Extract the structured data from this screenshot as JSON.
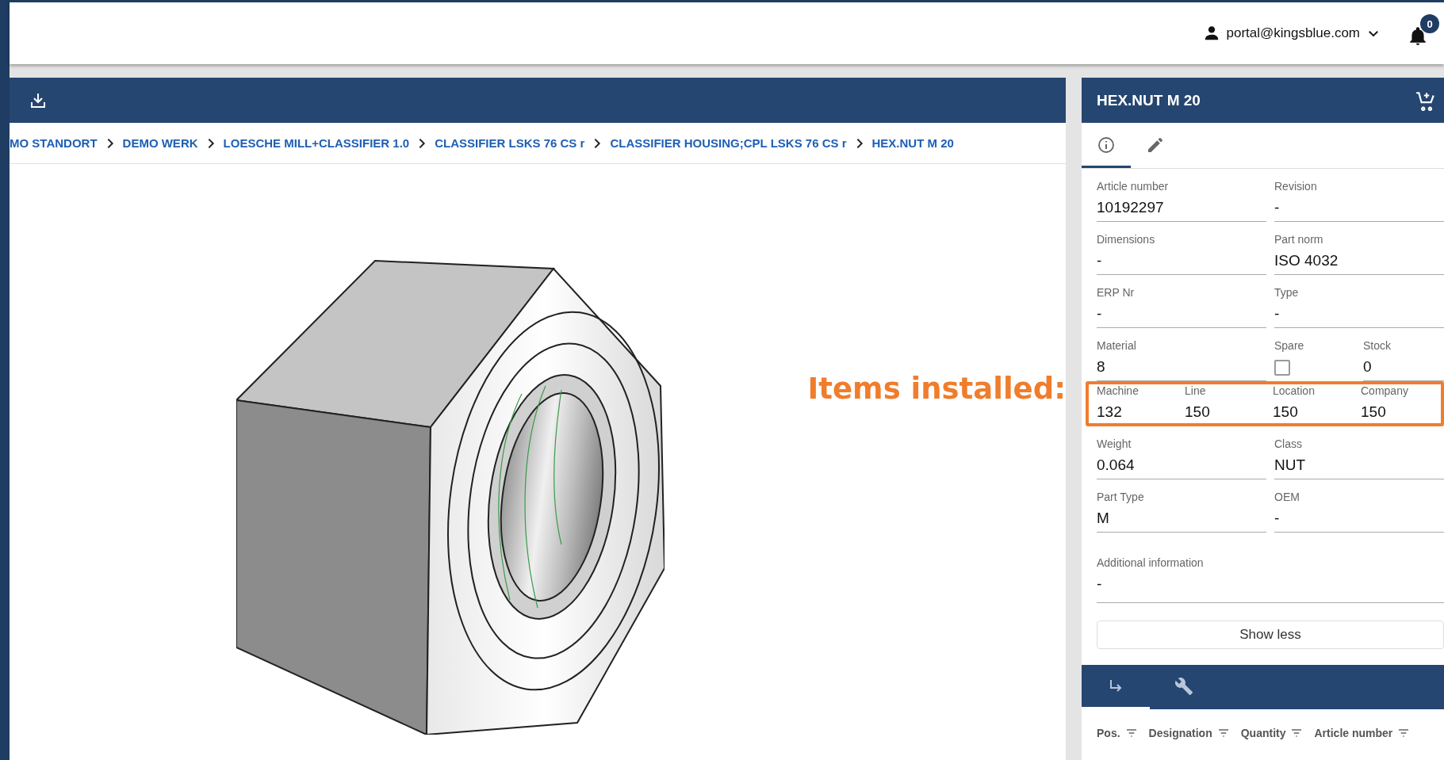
{
  "top_bar": {
    "user": "portal@kingsblue.com",
    "notifications": "0"
  },
  "breadcrumb": [
    "MO STANDORT",
    "DEMO WERK",
    "LOESCHE MILL+CLASSIFIER 1.0",
    "CLASSIFIER LSKS 76 CS r",
    "CLASSIFIER HOUSING;CPL LSKS 76 CS r",
    "HEX.NUT M 20"
  ],
  "annotation": {
    "text": "Items installed:"
  },
  "detail": {
    "title": "HEX.NUT M 20",
    "tabs": [
      {
        "selected": true
      },
      {
        "selected": false
      }
    ],
    "field_groups_top": [
      {
        "fields": [
          {
            "kind": "text",
            "label": "Article number",
            "value": "10192297"
          },
          {
            "kind": "text",
            "label": "Revision",
            "value": "-"
          }
        ]
      },
      {
        "fields": [
          {
            "kind": "text",
            "label": "Dimensions",
            "value": "-"
          },
          {
            "kind": "text",
            "label": "Part norm",
            "value": "ISO 4032"
          }
        ]
      },
      {
        "fields": [
          {
            "kind": "text",
            "label": "ERP Nr",
            "value": "-"
          },
          {
            "kind": "text",
            "label": "Type",
            "value": "-"
          }
        ]
      },
      {
        "fields": [
          {
            "kind": "text",
            "label": "Material",
            "value": "8"
          },
          {
            "kind": "checkbox",
            "label": "Spare",
            "checked": false
          },
          {
            "kind": "text",
            "label": "Stock",
            "value": "0"
          }
        ]
      }
    ],
    "items_installed": [
      {
        "label": "Machine",
        "value": "132"
      },
      {
        "label": "Line",
        "value": "150"
      },
      {
        "label": "Location",
        "value": "150"
      },
      {
        "label": "Company",
        "value": "150"
      }
    ],
    "field_groups_bottom": [
      {
        "fields": [
          {
            "kind": "text",
            "label": "Weight",
            "value": "0.064"
          },
          {
            "kind": "text",
            "label": "Class",
            "value": "NUT"
          }
        ]
      },
      {
        "fields": [
          {
            "kind": "text",
            "label": "Part Type",
            "value": "M"
          },
          {
            "kind": "text",
            "label": "OEM",
            "value": "-"
          }
        ]
      },
      {
        "fields": [
          {
            "kind": "text",
            "label": "Additional information",
            "value": "-"
          }
        ]
      }
    ],
    "show_less": "Show less",
    "bottom_tabs": [
      {
        "selected": true
      },
      {
        "selected": false
      }
    ],
    "columns": [
      "Pos.",
      "Designation",
      "Quantity",
      "Article number"
    ]
  }
}
